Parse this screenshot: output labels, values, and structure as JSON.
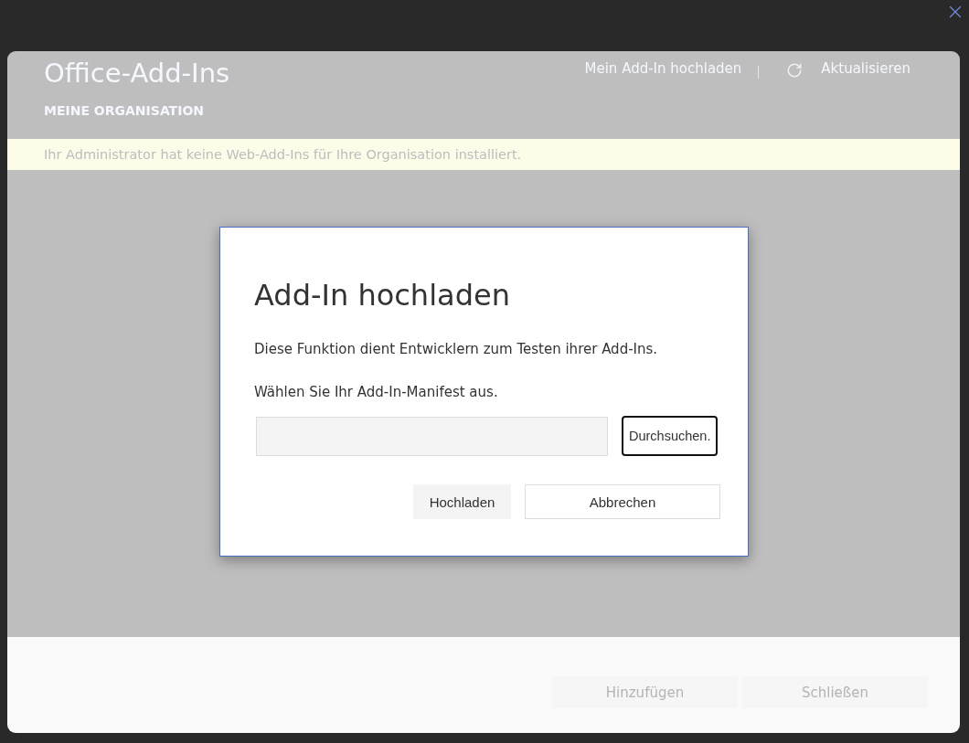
{
  "window": {
    "title": "Office-Add-Ins",
    "section": "MEINE ORGANISATION",
    "actions": [
      {
        "kind": "link",
        "label": "Mein Add-In hochladen"
      },
      {
        "kind": "refresh",
        "label": "Aktualisieren"
      }
    ],
    "notice": "Ihr Administrator hat keine Web-Add-Ins für Ihre Organisation installiert.",
    "footer_buttons": [
      {
        "label": "Hinzufügen",
        "disabled": true
      },
      {
        "label": "Schließen",
        "disabled": true
      }
    ]
  },
  "dialog": {
    "title": "Add-In hochladen",
    "description": "Diese Funktion dient Entwicklern zum Testen ihrer Add-Ins.",
    "prompt": "Wählen Sie Ihr Add-In-Manifest aus.",
    "browse_button": {
      "label": "Durchsuchen.",
      "focused": true
    },
    "buttons": [
      {
        "kind": "primary",
        "label": "Hochladen"
      },
      {
        "kind": "secondary",
        "label": "Abbrechen"
      }
    ]
  }
}
